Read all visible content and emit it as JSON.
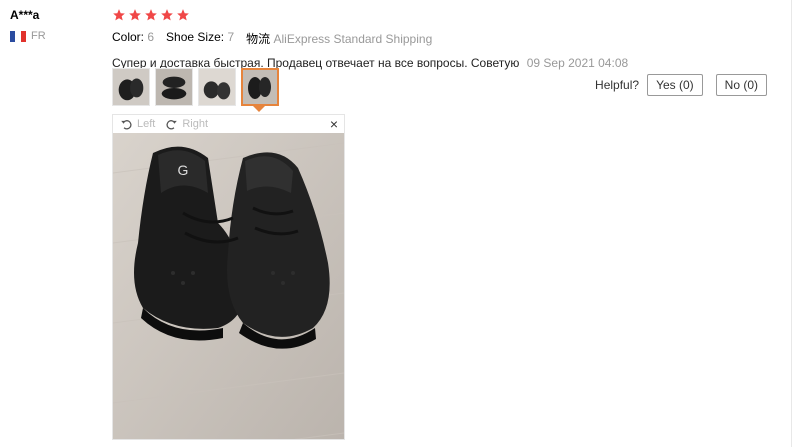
{
  "user": {
    "name": "A***a",
    "country_code": "FR"
  },
  "review": {
    "rating": 5,
    "attributes": [
      {
        "label": "Color:",
        "value": "6"
      },
      {
        "label": "Shoe Size:",
        "value": "7"
      },
      {
        "label": "物流",
        "value": "AliExpress Standard Shipping"
      }
    ],
    "text": "Супер и доставка быстрая. Продавец отвечает на все вопросы. Советую",
    "date": "09 Sep 2021 04:08"
  },
  "thumbnails": {
    "count": 4,
    "selected_index": 4
  },
  "helpful": {
    "label": "Helpful?",
    "yes_label": "Yes (0)",
    "no_label": "No (0)"
  },
  "viewer": {
    "rotate_left_label": "Left",
    "rotate_right_label": "Right",
    "close_icon": "×"
  },
  "colors": {
    "star": "#f04747",
    "accent": "#e6843c"
  }
}
